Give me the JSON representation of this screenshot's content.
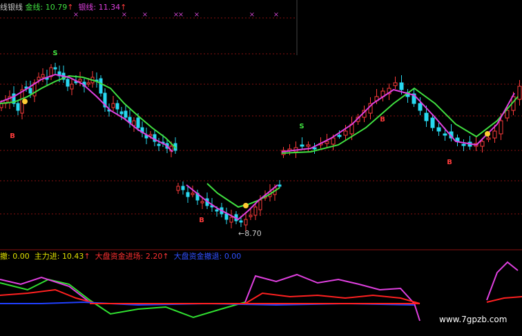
{
  "colors": {
    "background": "#000000",
    "up": "#ff3b3b",
    "down": "#28d8f0",
    "gold_line": "#40e040",
    "silver_line": "#e040e0",
    "grid_red": "#8a1010",
    "marker": "#cc44cc",
    "label_gray": "#c8c8c8",
    "blue": "#2040ff",
    "red": "#ff2020"
  },
  "top_legend": {
    "prefix": "线银线",
    "gold_label": "金线:",
    "gold_value": "10.79",
    "silver_label": "银线:",
    "silver_value": "11.34",
    "arrow": "↑"
  },
  "bottom_legend": {
    "item0_label": "撤:",
    "item0_value": "0.00",
    "item1_label": "主力进:",
    "item1_value": "10.43",
    "item2_label": "大盘资金进场:",
    "item2_value": "2.20",
    "item3_label": "大盘资金撤退:",
    "item3_value": "0.00",
    "arrow": "↑"
  },
  "annotations": {
    "min_price_label": "←8.70",
    "signal_buy": "B",
    "signal_sell": "S"
  },
  "watermark": "www.7gpzb.com",
  "chart_data": [
    {
      "type": "candlestick",
      "title": "",
      "series": [
        {
          "name": "金线",
          "value": 10.79
        },
        {
          "name": "银线",
          "value": 11.34
        }
      ],
      "price_markers": [
        {
          "label": "8.70",
          "value": 8.7
        }
      ],
      "signals": [
        "S",
        "B",
        "B",
        "S",
        "B",
        "B"
      ],
      "grid": true
    },
    {
      "type": "line",
      "series": [
        {
          "name": "主力进",
          "value": 10.43
        },
        {
          "name": "大盘资金进场",
          "value": 2.2
        },
        {
          "name": "大盘资金撤退",
          "value": 0.0
        }
      ]
    }
  ]
}
